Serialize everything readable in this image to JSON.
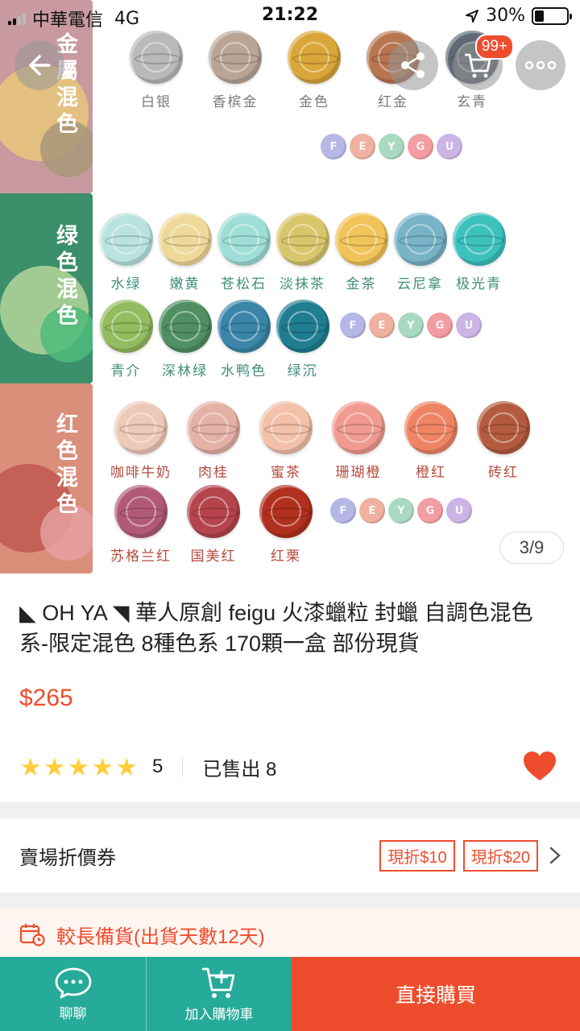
{
  "status_bar": {
    "carrier": "中華電信",
    "network": "4G",
    "time": "21:22",
    "battery": "30%",
    "battery_level": 0.3
  },
  "gallery": {
    "pager": "3/9",
    "cart_badge": "99+",
    "bands": [
      {
        "label": "金屬混色",
        "colors": [
          "#c89aa0",
          "#e9c77a",
          "#a89678"
        ],
        "rows": [
          {
            "seals": [
              {
                "name": "白银",
                "color": "#b9b9bc"
              },
              {
                "name": "香槟金",
                "color": "#b9a596"
              },
              {
                "name": "金色",
                "color": "#d9a63a"
              },
              {
                "name": "红金",
                "color": "#b87550"
              },
              {
                "name": "玄青",
                "color": "#5f6a76"
              }
            ],
            "letters": []
          },
          {
            "seals": [],
            "letters": [
              {
                "char": "F",
                "color": "#b5b7e6"
              },
              {
                "char": "E",
                "color": "#f0b1a0"
              },
              {
                "char": "Y",
                "color": "#a9d9c0"
              },
              {
                "char": "G",
                "color": "#f29da2"
              },
              {
                "char": "U",
                "color": "#ccb5e6"
              }
            ]
          }
        ]
      },
      {
        "label": "绿色混色",
        "colors": [
          "#3b8f6a",
          "#b5d69a",
          "#4fbb7a"
        ],
        "rows": [
          {
            "seals": [
              {
                "name": "水绿",
                "color": "#b9e3e1"
              },
              {
                "name": "嫩黄",
                "color": "#efd99a"
              },
              {
                "name": "苍松石",
                "color": "#9fded6"
              },
              {
                "name": "淡抹茶",
                "color": "#d8c66a"
              },
              {
                "name": "金茶",
                "color": "#f0c45a"
              },
              {
                "name": "云尼拿",
                "color": "#78b3c8"
              },
              {
                "name": "极光青",
                "color": "#3cc1bd"
              }
            ],
            "letters": []
          },
          {
            "seals": [
              {
                "name": "青介",
                "color": "#93bb5f"
              },
              {
                "name": "深林绿",
                "color": "#4f8f62"
              },
              {
                "name": "水鸭色",
                "color": "#3a85a8"
              },
              {
                "name": "绿沉",
                "color": "#1f7d8f"
              }
            ],
            "letters": [
              {
                "char": "F",
                "color": "#b5b7e6"
              },
              {
                "char": "E",
                "color": "#f0b1a0"
              },
              {
                "char": "Y",
                "color": "#a9d9c0"
              },
              {
                "char": "G",
                "color": "#f29da2"
              },
              {
                "char": "U",
                "color": "#ccb5e6"
              }
            ]
          }
        ]
      },
      {
        "label": "红色混色",
        "colors": [
          "#d98f7a",
          "#c0584f",
          "#e5a0a0"
        ],
        "rows": [
          {
            "seals": [
              {
                "name": "咖啡牛奶",
                "color": "#efc9b8"
              },
              {
                "name": "肉桂",
                "color": "#e4b1a6"
              },
              {
                "name": "蜜茶",
                "color": "#f2c1a8"
              },
              {
                "name": "珊瑚橙",
                "color": "#f19a8f"
              },
              {
                "name": "橙红",
                "color": "#ef8465"
              },
              {
                "name": "砖红",
                "color": "#b45a3e"
              }
            ],
            "letters": []
          },
          {
            "seals": [
              {
                "name": "苏格兰红",
                "color": "#b15a78"
              },
              {
                "name": "国美红",
                "color": "#b5444c"
              },
              {
                "name": "红栗",
                "color": "#b1301f"
              }
            ],
            "letters": [
              {
                "char": "F",
                "color": "#b5b7e6"
              },
              {
                "char": "E",
                "color": "#f0b1a0"
              },
              {
                "char": "Y",
                "color": "#a9d9c0"
              },
              {
                "char": "G",
                "color": "#f29da2"
              },
              {
                "char": "U",
                "color": "#ccb5e6"
              }
            ]
          }
        ]
      }
    ]
  },
  "product": {
    "title": "◣ OH YA ◥ 華人原創 feigu 火漆蠟粒 封蠟 自調色混色系-限定混色 8種色系 170顆一盒 部份現貨",
    "price": "$265",
    "rating": "5",
    "rating_stars": 5,
    "sold": "已售出 8"
  },
  "voucher": {
    "label": "賣場折價券",
    "tags": [
      "現折$10",
      "現折$20"
    ]
  },
  "preorder": {
    "text": "較長備貨(出貨天數12天)"
  },
  "bottom_bar": {
    "chat": "聊聊",
    "cart": "加入購物車",
    "buy": "直接購買"
  },
  "colors": {
    "accent": "#ee4d2d",
    "teal": "#26aa99",
    "star": "#ffce3d"
  }
}
